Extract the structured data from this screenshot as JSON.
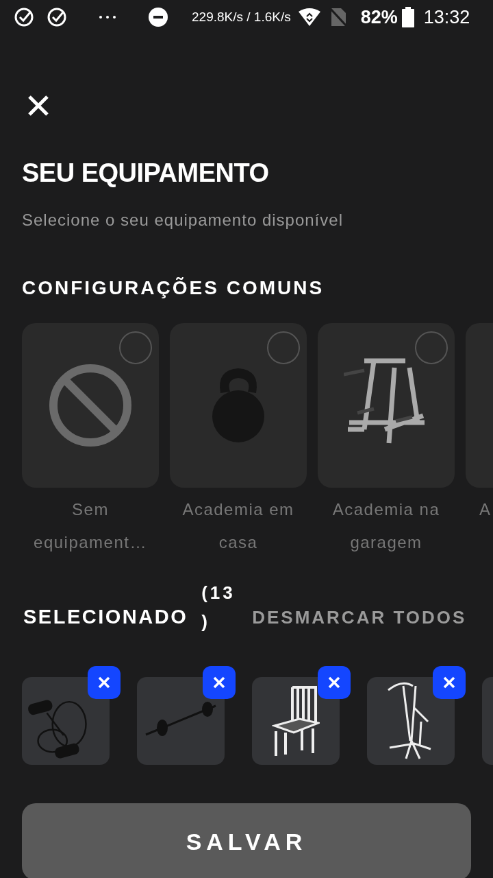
{
  "status_bar": {
    "speed": "229.8K/s / 1.6K/s",
    "battery": "82%",
    "time": "13:32"
  },
  "title": "SEU EQUIPAMENTO",
  "subtitle": "Selecione o seu equipamento disponível",
  "common_heading": "CONFIGURAÇÕES COMUNS",
  "configurations": [
    {
      "kind": "none",
      "label": "Sem equipament…",
      "selected": false
    },
    {
      "kind": "kettlebell",
      "label": "Academia em casa",
      "selected": false
    },
    {
      "kind": "rack",
      "label": "Academia na garagem",
      "selected": false
    },
    {
      "kind": "partial",
      "label": "A"
    }
  ],
  "selected_heading": "SELECIONADO",
  "selected_count": "(13)",
  "deselect_all": "DESMARCAR TODOS",
  "selected_items": [
    {
      "kind": "bands"
    },
    {
      "kind": "barbell"
    },
    {
      "kind": "chair"
    },
    {
      "kind": "tower"
    },
    {
      "kind": "partial"
    }
  ],
  "save_button": "SALVAR"
}
